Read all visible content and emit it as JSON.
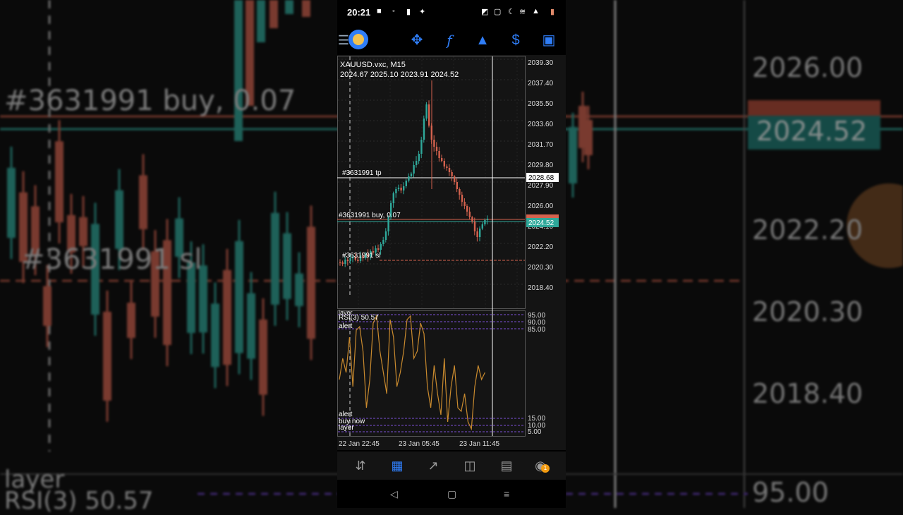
{
  "status_bar": {
    "time": "20:21",
    "icons": [
      "camera-icon",
      "bell-icon",
      "lock-icon",
      "settings-icon",
      "headphones-icon",
      "cast-icon",
      "moon-icon",
      "wifi-icon",
      "signal-icon",
      "battery-icon"
    ]
  },
  "toolbar": {
    "icons": [
      "menu-icon",
      "account-avatar-icon",
      "crosshair-icon",
      "indicator-icon",
      "objects-icon",
      "trade-icon",
      "new-order-icon"
    ],
    "indicator_glyph": "f"
  },
  "chart": {
    "symbol": "XAUUSD.vxc, M15",
    "ohlc": "2024.67 2025.10 2023.91 2024.52",
    "price_labels": [
      "2039.30",
      "2037.40",
      "2035.50",
      "2033.60",
      "2031.70",
      "2029.80",
      "2027.90",
      "2026.00",
      "2024.10",
      "2022.20",
      "2020.30",
      "2018.40"
    ],
    "crosshair_price": "2028.68",
    "current_price": "2024.52",
    "line_labels": {
      "tp": "#3631991 tp",
      "buy": "#3631991 buy, 0.07",
      "sl": "#3631991 sl"
    },
    "colors": {
      "up": "#2fa89a",
      "down": "#d4624e",
      "rsi": "#c98a2e",
      "level": "#7c4fd6",
      "sl": "#d4624e"
    }
  },
  "rsi": {
    "title": "RSI(3) 50.57",
    "labels": [
      "95.00",
      "90.00",
      "85.00",
      "15.00",
      "10.00",
      "5.00"
    ],
    "level_tags": [
      "layer",
      "alert",
      "alert",
      "buy now",
      "layer"
    ]
  },
  "time_axis": [
    "22 Jan 22:45",
    "23 Jan 05:45",
    "23 Jan 11:45"
  ],
  "bottom_nav": {
    "icons": [
      "quotes-icon",
      "chart-icon",
      "trade-icon",
      "history-icon",
      "news-icon",
      "messages-icon"
    ],
    "badge": "1"
  },
  "system_nav": {
    "icons": [
      "back-icon",
      "home-icon",
      "recents-icon"
    ]
  },
  "background": {
    "order_text": "#3631991 buy, 0.07",
    "sl_text": "#3631991 sl",
    "prices": [
      "2026.00",
      "2024.52",
      "2022.20",
      "2020.30",
      "2018.40"
    ],
    "rsi_title": "RSI(3) 50.57",
    "rsi_level": "95.00",
    "layer": "layer"
  }
}
